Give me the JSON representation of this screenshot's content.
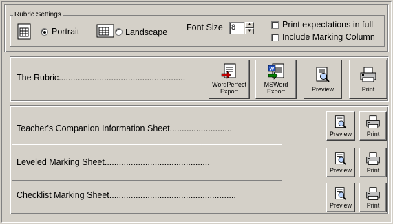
{
  "rubric_settings": {
    "legend": "Rubric Settings",
    "portrait_label": "Portrait",
    "landscape_label": "Landscape",
    "orientation_selected": "Portrait",
    "font_size_label": "Font Size",
    "font_size_value": "8",
    "print_expectations_label": "Print expectations in full",
    "include_marking_label": "Include Marking Column",
    "print_expectations_checked": false,
    "include_marking_checked": false
  },
  "rubric_row": {
    "title": "The Rubric.....................................................",
    "wordperfect_label_1": "WordPerfect",
    "wordperfect_label_2": "Export",
    "msword_label_1": "MSWord",
    "msword_label_2": "Export",
    "preview_label": "Preview",
    "print_label": "Print"
  },
  "sheets": [
    {
      "title": "Teacher's Companion Information Sheet..........................",
      "preview_label": "Preview",
      "print_label": "Print"
    },
    {
      "title": "Leveled Marking Sheet............................................",
      "preview_label": "Preview",
      "print_label": "Print"
    },
    {
      "title": "Checklist Marking Sheet.....................................................",
      "preview_label": "Preview",
      "print_label": "Print"
    }
  ],
  "colors": {
    "face": "#d4d0c8",
    "shadow": "#808080",
    "highlight": "#ffffff"
  },
  "icons": [
    "page-portrait-icon",
    "page-landscape-icon",
    "wordperfect-export-icon",
    "msword-export-icon",
    "preview-icon",
    "printer-icon"
  ]
}
